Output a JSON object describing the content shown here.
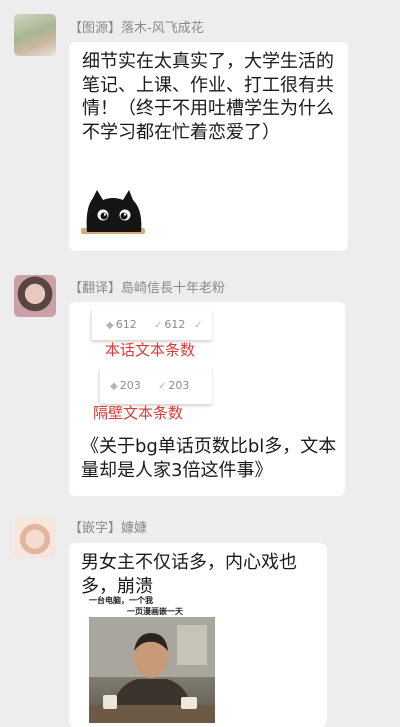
{
  "messages": [
    {
      "sender_tag": "【图源】",
      "sender_name": "落木-风飞成花",
      "text": "细节实在太真实了，大学生活的笔记、上课、作业、打工很有共情！（终于不用吐槽学生为什么不学习都在忙着恋爱了）"
    },
    {
      "sender_tag": "【翻译】",
      "sender_name": "島崎信長十年老粉",
      "snippet1": {
        "likes": "612",
        "checks": "612",
        "label": "本话文本条数"
      },
      "snippet2": {
        "likes": "203",
        "checks": "203",
        "label": "隔壁文本条数"
      },
      "text": "《关于bg单话页数比bl多，文本量却是人家3倍这件事》"
    },
    {
      "sender_tag": "【嵌字】",
      "sender_name": "嫝嫝",
      "text": "男女主不仅话多，内心戏也多，崩溃",
      "meme_caption_1": "一台电脑，一个我",
      "meme_caption_2": "一页漫画嵌一天"
    }
  ]
}
